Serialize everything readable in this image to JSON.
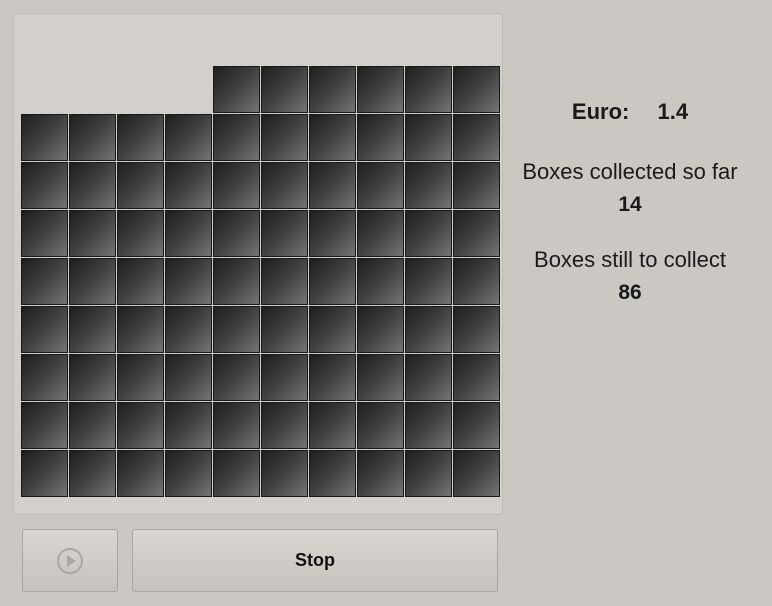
{
  "game": {
    "grid_columns": 10,
    "grid_rows": 9,
    "top_row_filled_from_column": 4,
    "box_colors": {
      "dark": "#1e1e1e",
      "mid": "#3d3d3d",
      "light": "#747474"
    }
  },
  "stats": {
    "euro_label": "Euro:",
    "euro_value": "1.4",
    "collected_label": "Boxes collected so far",
    "collected_value": "14",
    "remaining_label": "Boxes still to collect",
    "remaining_value": "86"
  },
  "controls": {
    "play_icon": "play-circle-icon",
    "stop_label": "Stop"
  },
  "colors": {
    "background": "#cbc7c3",
    "board": "#d3cfcb"
  }
}
